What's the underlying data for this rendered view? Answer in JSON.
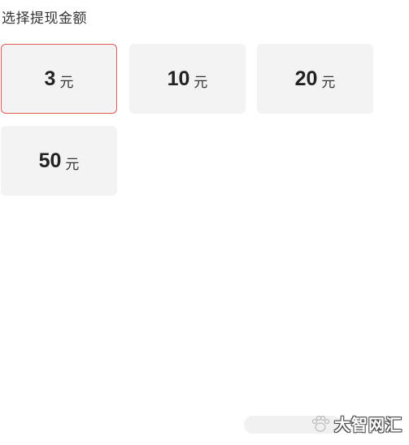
{
  "section": {
    "title": "选择提现金额"
  },
  "amounts": [
    {
      "value": "3",
      "unit": "元",
      "selected": true
    },
    {
      "value": "10",
      "unit": "元",
      "selected": false
    },
    {
      "value": "20",
      "unit": "元",
      "selected": false
    },
    {
      "value": "50",
      "unit": "元",
      "selected": false
    }
  ],
  "colors": {
    "selected_border": "#e05a5a",
    "option_background": "#f3f3f3"
  },
  "watermark": {
    "text": "大智网汇",
    "icon": "paw-icon"
  }
}
